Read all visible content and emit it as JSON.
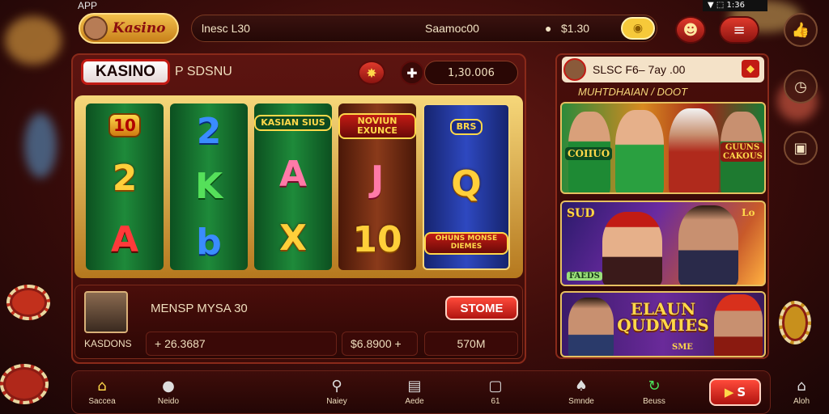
{
  "status": {
    "app": "APP",
    "right": "▼ ⬚ 1:36"
  },
  "brand": {
    "logo_text": "Kasino"
  },
  "topbar": {
    "left_text": "lnesc L30",
    "center_text": "Saamoc00",
    "right_text": "$1.30"
  },
  "machine": {
    "title": "KASINO",
    "subtitle": "P SDSNU",
    "balance": "1,30.006",
    "reels": [
      {
        "color": "green",
        "symbols": [
          "10",
          "2",
          "A"
        ]
      },
      {
        "color": "green",
        "symbols": [
          "2",
          "K",
          "b"
        ]
      },
      {
        "color": "green",
        "symbols": [
          "KASIAN SIUS",
          "A",
          "X"
        ]
      },
      {
        "color": "brown",
        "symbols": [
          "NOVIUN EXUNCE",
          "J",
          "10"
        ]
      },
      {
        "color": "blue",
        "symbols": [
          "BRS",
          "Q",
          "OHUNS MONSE DIEMES"
        ]
      }
    ]
  },
  "player": {
    "name_line": "MENSP MYSA 30",
    "label": "KASDONS",
    "value_left": "+ 26.3687",
    "value_mid": "$6.8900 +",
    "value_right": "570M",
    "action_label": "STOME"
  },
  "sidepanel": {
    "header": "SLSC F6– 7ay .00",
    "subheader": "MUHTDHAIAN / DOOT",
    "cards": [
      {
        "overlay_a": "COIIUO",
        "overlay_b": "GUUNS CAKOUS"
      },
      {
        "overlay_a": "SUD",
        "overlay_b": "Lo",
        "overlay_c": "FAEDS"
      },
      {
        "overlay_a": "ELAUN QUDMIES",
        "overlay_b": "SME"
      }
    ]
  },
  "nav": [
    {
      "label": "Saccea",
      "icon": "home-icon"
    },
    {
      "label": "Neido",
      "icon": "profile-icon"
    },
    {
      "label": "Naiey",
      "icon": "search-icon"
    },
    {
      "label": "Aede",
      "icon": "document-icon"
    },
    {
      "label": "61",
      "icon": "chat-icon"
    },
    {
      "label": "Smnde",
      "icon": "casino-icon"
    },
    {
      "label": "Beuss",
      "icon": "refresh-icon"
    },
    {
      "label": "S",
      "icon": "play-icon"
    },
    {
      "label": "Aloh",
      "icon": "house-icon"
    }
  ],
  "colors": {
    "accent_red": "#c21b14",
    "gold": "#f6d77a",
    "panel_bg": "#3b0b08"
  }
}
